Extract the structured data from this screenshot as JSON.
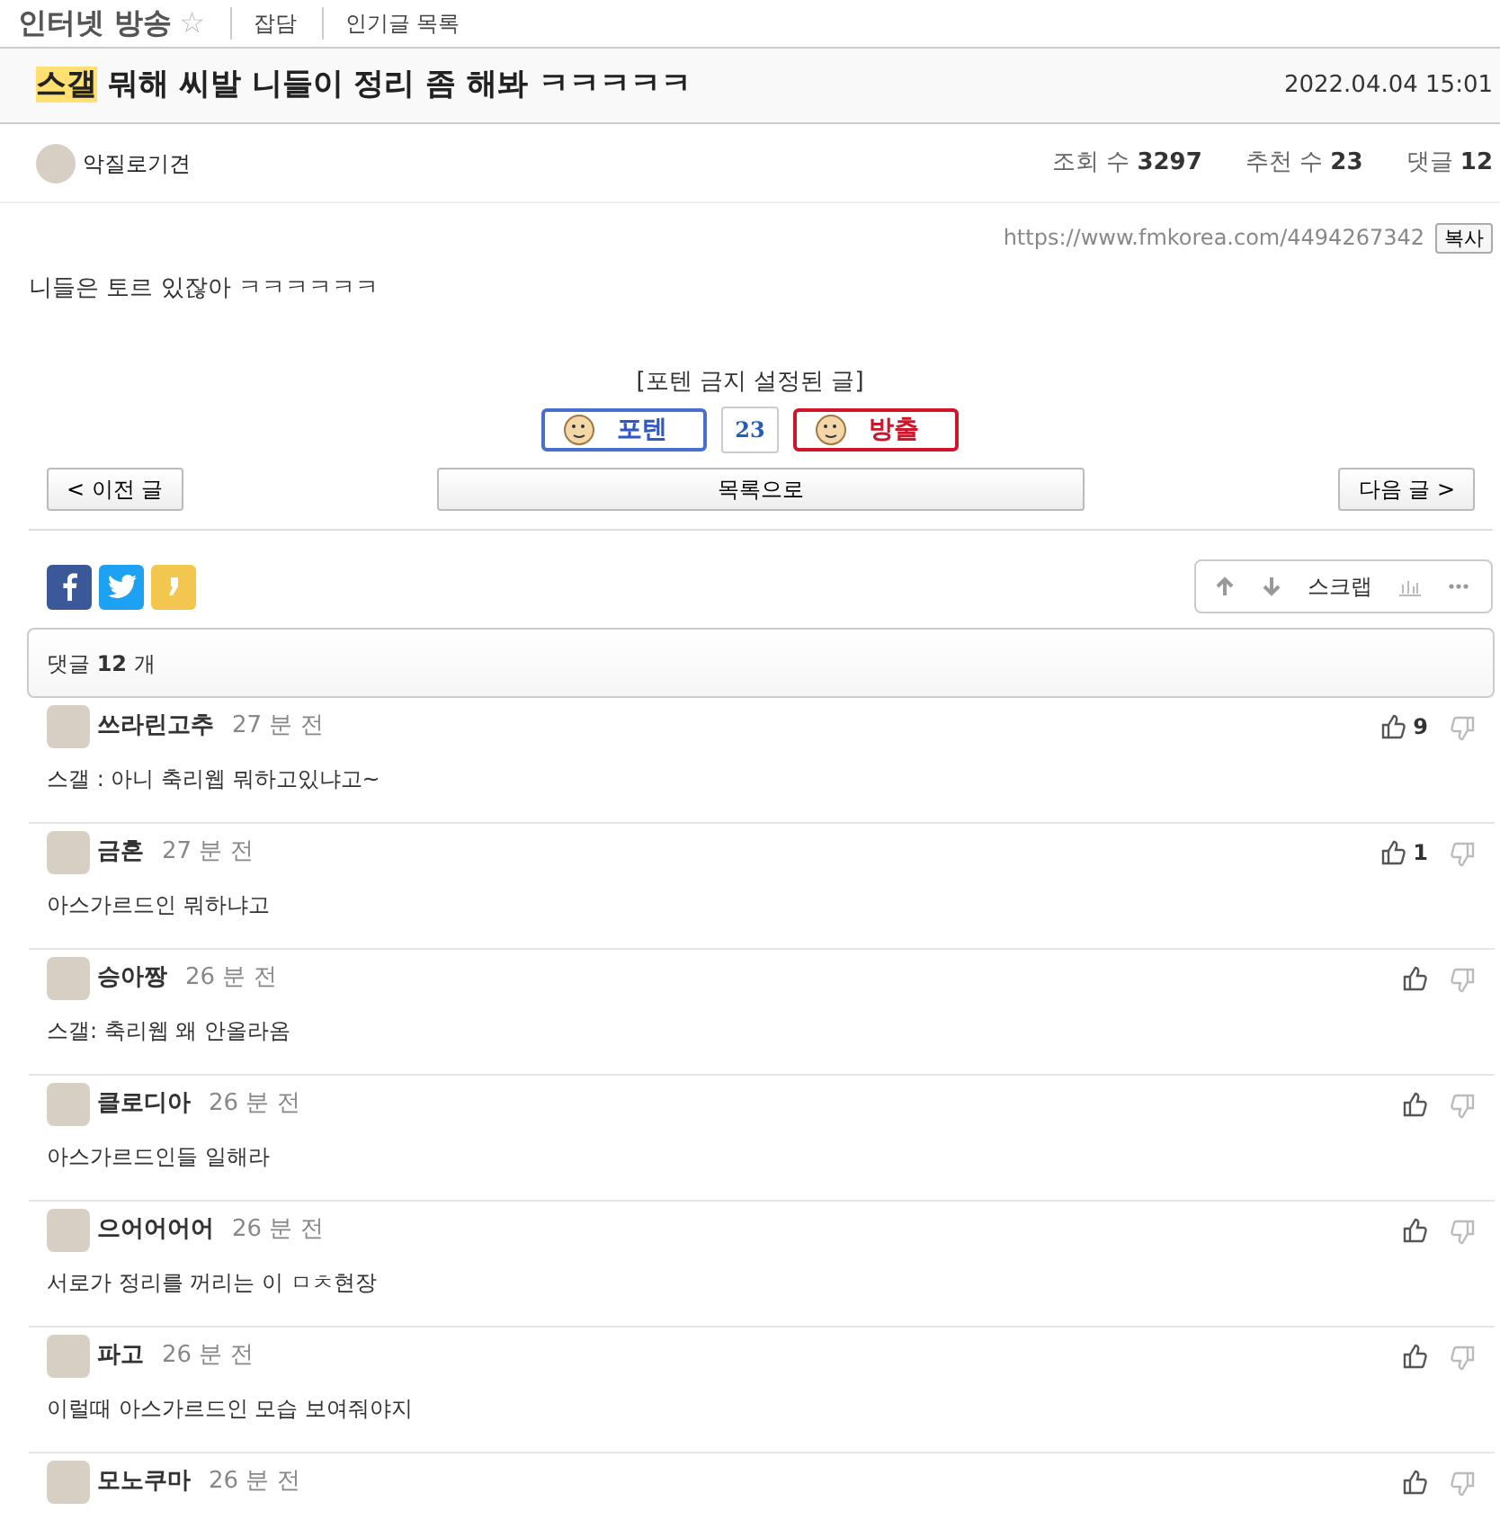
{
  "board_header": {
    "board_title": "인터넷 방송",
    "star": "☆",
    "links": [
      "잡담",
      "인기글 목록"
    ]
  },
  "post": {
    "tag": "스갤",
    "title": "뭐해 씨발 니들이 정리 좀 해봐 ㅋㅋㅋㅋㅋ",
    "date": "2022.04.04 15:01",
    "author": "악질로기견",
    "stats": [
      {
        "label": "조회 수",
        "value": "3297"
      },
      {
        "label": "추천 수",
        "value": "23"
      },
      {
        "label": "댓글",
        "value": "12"
      }
    ],
    "url": "https://www.fmkorea.com/4494267342",
    "copy_button": "복사",
    "body": "니들은 토르 있잖아 ㅋㅋㅋㅋㅋㅋ"
  },
  "vote": {
    "notice": "[포텐 금지 설정된 글]",
    "up_label": "포텐",
    "count": "23",
    "down_label": "방출"
  },
  "navigation": {
    "prev": "< 이전 글",
    "list": "목록으로",
    "next": "다음 글 >"
  },
  "share": {
    "scrap": "스크랩"
  },
  "comment_count": {
    "label": "댓글",
    "count": "12",
    "unit": "개"
  },
  "comments": [
    {
      "name": "쓰라린고추",
      "time": "27 분 전",
      "likes": "9",
      "text": "스갤 : 아니 축리웹 뭐하고있냐고~"
    },
    {
      "name": "금혼",
      "time": "27 분 전",
      "likes": "1",
      "text": "아스가르드인 뭐하냐고"
    },
    {
      "name": "승아짱",
      "time": "26 분 전",
      "text": "스갤: 축리웹 왜 안올라옴"
    },
    {
      "name": "클로디아",
      "time": "26 분 전",
      "text": "아스가르드인들 일해라"
    },
    {
      "name": "으어어어어",
      "time": "26 분 전",
      "text": "서로가 정리를 꺼리는 이 ㅁㅊ현장"
    },
    {
      "name": "파고",
      "time": "26 분 전",
      "text": "이럴때 아스가르드인 모습 보여줘야지"
    },
    {
      "name": "모노쿠마",
      "time": "26 분 전"
    }
  ]
}
